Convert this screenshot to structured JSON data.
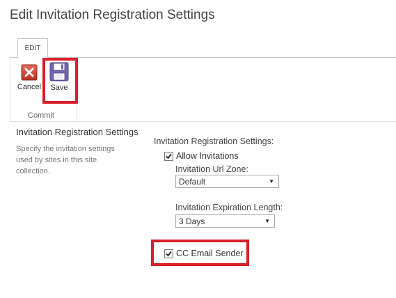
{
  "page": {
    "title": "Edit Invitation Registration Settings"
  },
  "ribbon": {
    "tab_label": "EDIT",
    "cancel_label": "Cancel",
    "save_label": "Save",
    "group_label": "Commit"
  },
  "section": {
    "title": "Invitation Registration Settings",
    "description": "Specify the invitation settings used by sites in this site collection."
  },
  "form": {
    "settings_label": "Invitation Registration Settings:",
    "allow_invitations": {
      "label": "Allow Invitations",
      "checked": true
    },
    "url_zone": {
      "label": "Invitation Url Zone:",
      "selected": "Default"
    },
    "expiration": {
      "label": "Invitation Expiration Length:",
      "selected": "3 Days"
    },
    "cc_email_sender": {
      "label": "CC Email Sender",
      "checked": true
    }
  },
  "colors": {
    "highlight": "#d81f2a",
    "cancel_icon": "#c0392b",
    "save_icon": "#7466b1"
  },
  "icons": {
    "cancel": "cancel-x-icon",
    "save": "floppy-disk-icon",
    "dropdown": "chevron-down-icon",
    "checkbox": "checkmark-icon"
  }
}
